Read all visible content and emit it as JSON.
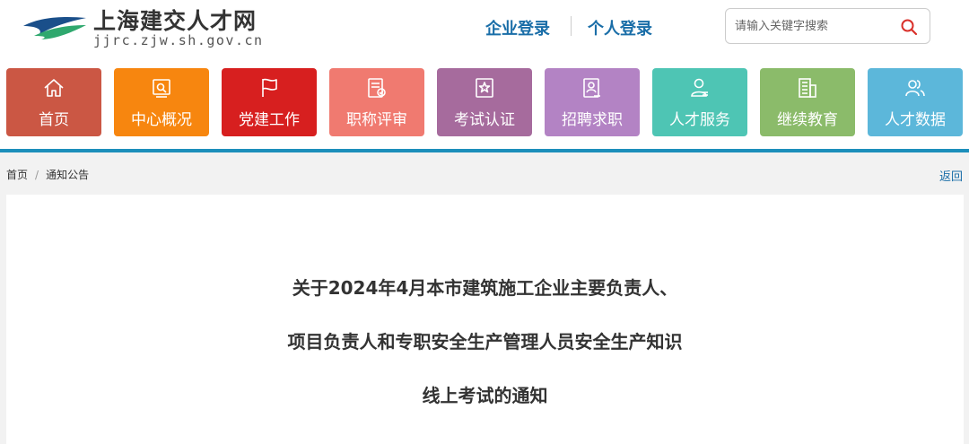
{
  "site": {
    "name": "上海建交人才网",
    "url": "jjrc.zjw.sh.gov.cn"
  },
  "header": {
    "enterprise_login": "企业登录",
    "personal_login": "个人登录",
    "search_placeholder": "请输入关键字搜索"
  },
  "nav": [
    {
      "label": "首页",
      "icon": "home-icon",
      "color": "#cb5744"
    },
    {
      "label": "中心概况",
      "icon": "overview-icon",
      "color": "#f7860f"
    },
    {
      "label": "党建工作",
      "icon": "flag-icon",
      "color": "#d71f1f"
    },
    {
      "label": "职称评审",
      "icon": "review-icon",
      "color": "#f07a70"
    },
    {
      "label": "考试认证",
      "icon": "certificate-icon",
      "color": "#a66b9d"
    },
    {
      "label": "招聘求职",
      "icon": "resume-icon",
      "color": "#b383c4"
    },
    {
      "label": "人才服务",
      "icon": "person-service-icon",
      "color": "#4ec5b4"
    },
    {
      "label": "继续教育",
      "icon": "building-icon",
      "color": "#8bbb6a"
    },
    {
      "label": "人才数据",
      "icon": "users-icon",
      "color": "#5cb7da"
    }
  ],
  "breadcrumb": {
    "home": "首页",
    "separator": "/",
    "current": "通知公告",
    "back": "返回"
  },
  "article": {
    "title_lines": [
      "关于2024年4月本市建筑施工企业主要负责人、",
      "项目负责人和专职安全生产管理人员安全生产知识",
      "线上考试的通知"
    ]
  },
  "colors": {
    "accent": "#1c8fbb",
    "link": "#1a6ea8"
  }
}
